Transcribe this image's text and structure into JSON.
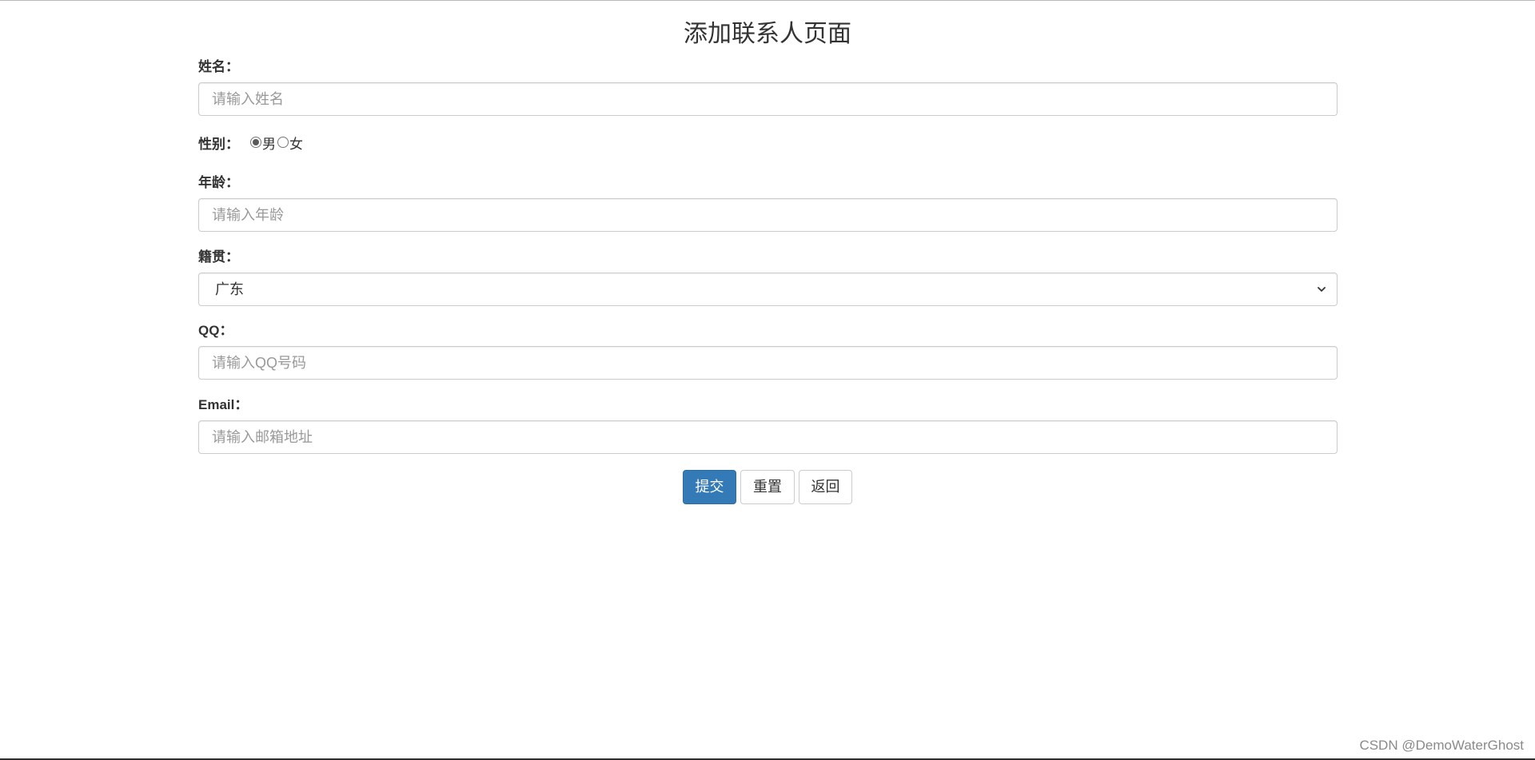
{
  "page": {
    "title": "添加联系人页面"
  },
  "form": {
    "name": {
      "label": "姓名：",
      "placeholder": "请输入姓名",
      "value": ""
    },
    "gender": {
      "label": "性别：",
      "options": [
        {
          "label": "男",
          "checked": true
        },
        {
          "label": "女",
          "checked": false
        }
      ]
    },
    "age": {
      "label": "年龄：",
      "placeholder": "请输入年龄",
      "value": ""
    },
    "hometown": {
      "label": "籍贯：",
      "selected": "广东"
    },
    "qq": {
      "label": "QQ：",
      "placeholder": "请输入QQ号码",
      "value": ""
    },
    "email": {
      "label": "Email：",
      "placeholder": "请输入邮箱地址",
      "value": ""
    }
  },
  "buttons": {
    "submit": "提交",
    "reset": "重置",
    "back": "返回"
  },
  "watermark": "CSDN @DemoWaterGhost",
  "colors": {
    "primary": "#337ab7",
    "border": "#cccccc",
    "text": "#333333",
    "placeholder": "#999999"
  }
}
